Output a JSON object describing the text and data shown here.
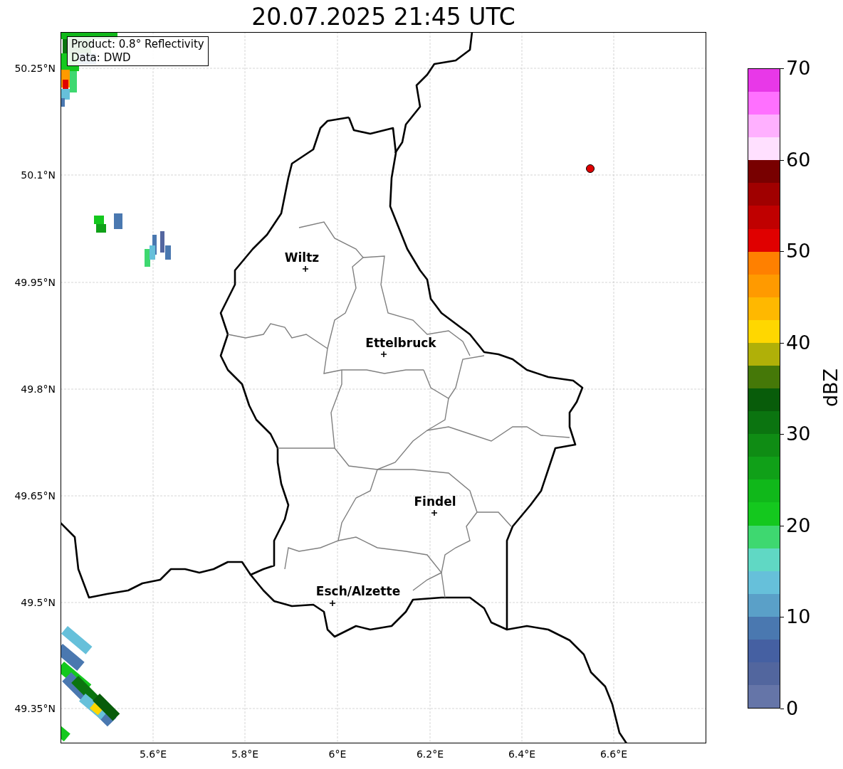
{
  "title": "20.07.2025 21:45 UTC",
  "info_box": [
    "Product: 0.8° Reflectivity",
    "Data: DWD"
  ],
  "map": {
    "y_ticks": [
      "50.25°N",
      "50.1°N",
      "49.95°N",
      "49.8°N",
      "49.65°N",
      "49.5°N",
      "49.35°N"
    ],
    "x_ticks": [
      "5.6°E",
      "5.8°E",
      "6°E",
      "6.2°E",
      "6.4°E",
      "6.6°E"
    ],
    "places": [
      {
        "name": "Wiltz"
      },
      {
        "name": "Ettelbruck"
      },
      {
        "name": "Findel"
      },
      {
        "name": "Esch/Alzette"
      }
    ]
  },
  "colorbar": {
    "label": "dBZ",
    "ticks": [
      "70",
      "60",
      "50",
      "40",
      "30",
      "20",
      "10",
      "0"
    ],
    "bins": [
      {
        "color": "#e838e8"
      },
      {
        "color": "#ff70ff"
      },
      {
        "color": "#ffb0ff"
      },
      {
        "color": "#ffe0ff"
      },
      {
        "color": "#780000"
      },
      {
        "color": "#a00000"
      },
      {
        "color": "#c00000"
      },
      {
        "color": "#e00000"
      },
      {
        "color": "#ff8000"
      },
      {
        "color": "#ff9a00"
      },
      {
        "color": "#ffb800"
      },
      {
        "color": "#ffd700"
      },
      {
        "color": "#b0b008"
      },
      {
        "color": "#457808"
      },
      {
        "color": "#085c0a"
      },
      {
        "color": "#0b7410"
      },
      {
        "color": "#0f8c14"
      },
      {
        "color": "#10a018"
      },
      {
        "color": "#10b81a"
      },
      {
        "color": "#14c81e"
      },
      {
        "color": "#3ed870"
      },
      {
        "color": "#60d8c4"
      },
      {
        "color": "#66c0da"
      },
      {
        "color": "#5aa0c8"
      },
      {
        "color": "#4a78b0"
      },
      {
        "color": "#4560a2"
      },
      {
        "color": "#52669e"
      },
      {
        "color": "#6575a8"
      }
    ]
  }
}
